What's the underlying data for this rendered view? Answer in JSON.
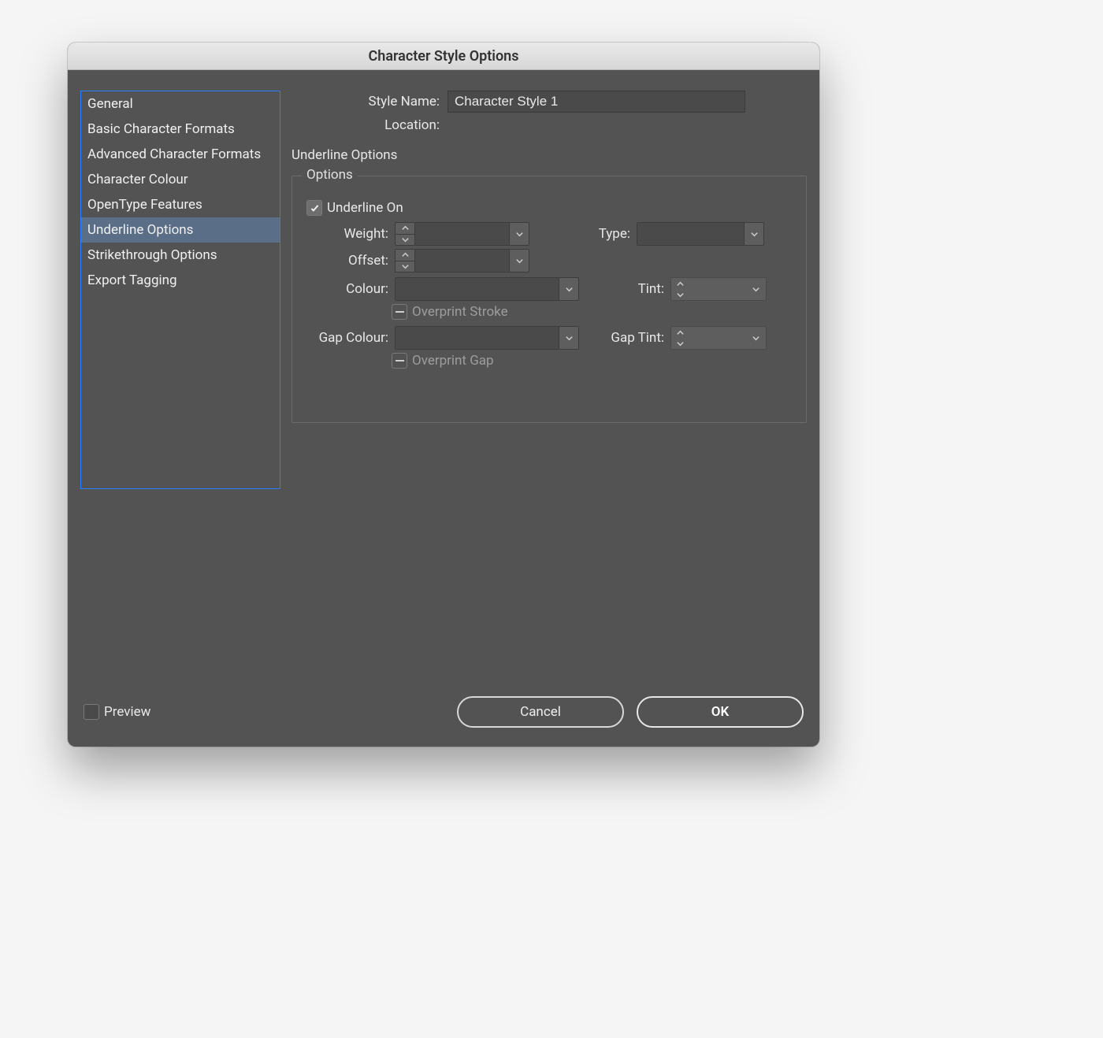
{
  "window": {
    "title": "Character Style Options"
  },
  "sidebar": {
    "items": [
      "General",
      "Basic Character Formats",
      "Advanced Character Formats",
      "Character Colour",
      "OpenType Features",
      "Underline Options",
      "Strikethrough Options",
      "Export Tagging"
    ],
    "selected_index": 5
  },
  "header": {
    "style_name_label": "Style Name:",
    "style_name_value": "Character Style 1",
    "location_label": "Location:",
    "location_value": ""
  },
  "panel": {
    "section_title": "Underline Options",
    "fieldset_title": "Options",
    "underline_on_label": "Underline On",
    "underline_on_checked": true,
    "weight_label": "Weight:",
    "offset_label": "Offset:",
    "type_label": "Type:",
    "colour_label": "Colour:",
    "tint_label": "Tint:",
    "gap_colour_label": "Gap Colour:",
    "gap_tint_label": "Gap Tint:",
    "overprint_stroke_label": "Overprint Stroke",
    "overprint_gap_label": "Overprint Gap",
    "weight_value": "",
    "offset_value": "",
    "type_value": "",
    "colour_value": "",
    "tint_value": "",
    "gap_colour_value": "",
    "gap_tint_value": ""
  },
  "footer": {
    "preview_label": "Preview",
    "preview_checked": false,
    "cancel_label": "Cancel",
    "ok_label": "OK"
  }
}
